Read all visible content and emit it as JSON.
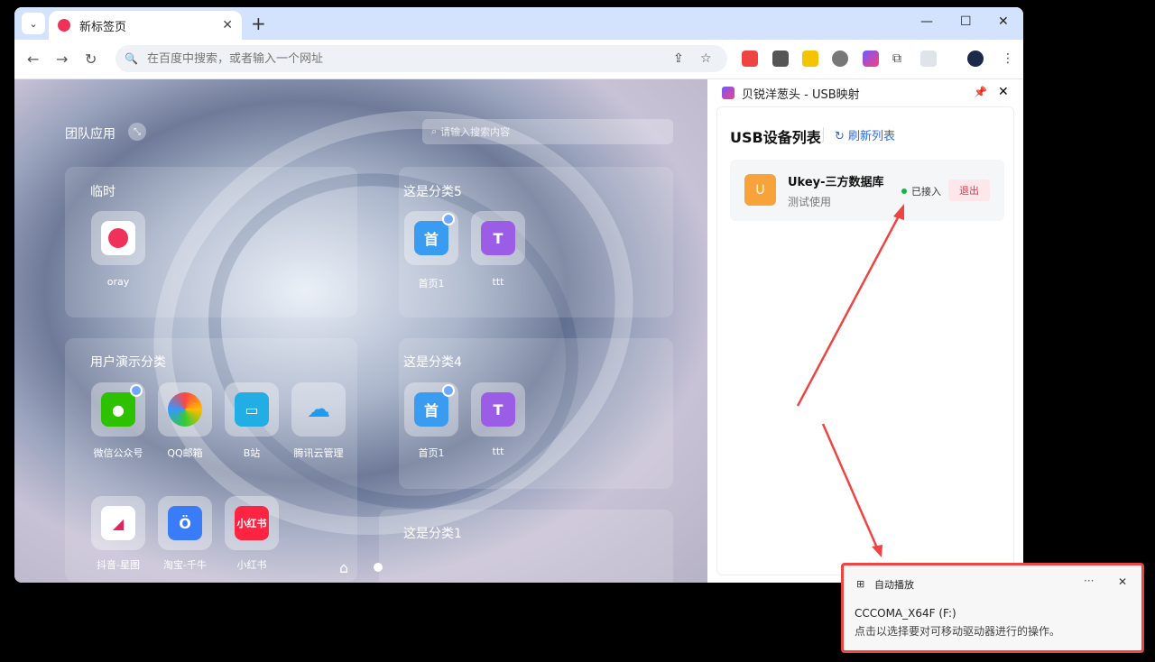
{
  "browser": {
    "tab_title": "新标签页",
    "omnibox_placeholder": "在百度中搜索，或者输入一个网址"
  },
  "ntp": {
    "team_apps_title": "团队应用",
    "search_placeholder": "请输入搜索内容",
    "categories": [
      {
        "title": "临时",
        "apps": [
          {
            "label": "oray",
            "icon": "oray-icon"
          }
        ]
      },
      {
        "title": "这是分类5",
        "apps": [
          {
            "label": "首页1",
            "icon_text": "首"
          },
          {
            "label": "ttt",
            "icon_text": "T"
          }
        ]
      },
      {
        "title": "用户演示分类",
        "apps": [
          {
            "label": "微信公众号",
            "icon": "wechat-icon"
          },
          {
            "label": "QQ邮箱",
            "icon": "qqmail-icon"
          },
          {
            "label": "B站",
            "icon": "bilibili-icon"
          },
          {
            "label": "腾讯云管理",
            "icon": "tencent-cloud-icon"
          },
          {
            "label": "抖音-星图",
            "icon": "douyin-xingtu-icon"
          },
          {
            "label": "淘宝-千牛",
            "icon": "qianniu-icon"
          },
          {
            "label": "小红书",
            "icon_text": "小红书"
          }
        ]
      },
      {
        "title": "这是分类4",
        "apps": [
          {
            "label": "首页1",
            "icon_text": "首"
          },
          {
            "label": "ttt",
            "icon_text": "T"
          }
        ]
      },
      {
        "title": "这是分类1",
        "apps": []
      }
    ]
  },
  "side_panel": {
    "title": "贝锐洋葱头 - USB映射",
    "list_title": "USB设备列表",
    "refresh_label": "刷新列表",
    "device": {
      "icon_text": "U",
      "name": "Ukey-三方数据库",
      "subtitle": "测试使用",
      "status": "已接入",
      "exit_label": "退出"
    }
  },
  "toast": {
    "title": "自动播放",
    "more": "···",
    "line1": "CCCOMA_X64F (F:)",
    "line2": "点击以选择要对可移动驱动器进行的操作。"
  },
  "colors": {
    "accent": "#2a6af5",
    "status_ok": "#16b24a",
    "exit_text": "#e8384f",
    "highlight": "#e44444"
  }
}
